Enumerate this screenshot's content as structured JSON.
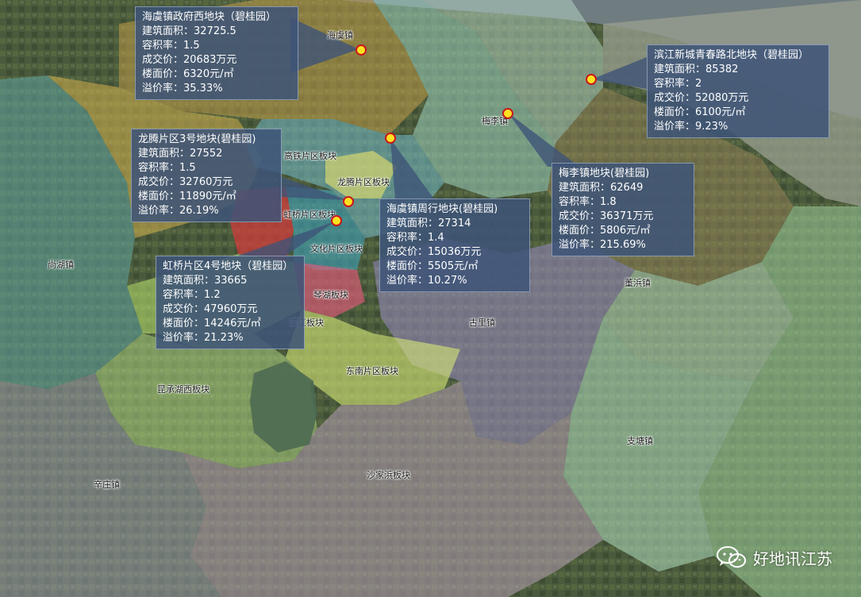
{
  "regions": {
    "haiyu": "海虞镇",
    "meili": "梅李镇",
    "longteng": "龙腾片区板块",
    "gaotie": "高铁片区板块",
    "hongqiao": "虹桥片区板块",
    "wenhua": "文化片区板块",
    "qinhu": "琴湖板块",
    "bingjiang": "滨江板块",
    "shanghu": "尚湖镇",
    "guli": "古里镇",
    "dongbang": "董浜镇",
    "dongnan": "东南片区板块",
    "kunchenghu": "昆承湖西板块",
    "zhitang": "支塘镇",
    "xinzhuang": "辛庄镇",
    "shajiabang": "沙家浜板块"
  },
  "parcels": [
    {
      "name": "海虞镇政府西地块（碧桂园）",
      "area": "建筑面积：32725.5",
      "far": "容积率：1.5",
      "price": "成交价：20683万元",
      "unit_price": "楼面价：6320元/㎡",
      "premium": "溢价率：35.33%"
    },
    {
      "name": "滨江新城青春路北地块（碧桂园）",
      "area": "建筑面积：85382",
      "far": "容积率：2",
      "price": "成交价：52080万元",
      "unit_price": "楼面价：6100元/㎡",
      "premium": "溢价率：9.23%"
    },
    {
      "name": "龙腾片区3号地块(碧桂园)",
      "area": "建筑面积：27552",
      "far": "容积率：1.5",
      "price": "成交价：32760万元",
      "unit_price": "楼面价：11890元/㎡",
      "premium": "溢价率：26.19%"
    },
    {
      "name": "梅李镇地块(碧桂园)",
      "area": "建筑面积：62649",
      "far": "容积率：1.8",
      "price": "成交价：36371万元",
      "unit_price": "楼面价：5806元/㎡",
      "premium": "溢价率：215.69%"
    },
    {
      "name": "海虞镇周行地块(碧桂园)",
      "area": "建筑面积：27314",
      "far": "容积率：1.4",
      "price": "成交价：15036万元",
      "unit_price": "楼面价：5505元/㎡",
      "premium": "溢价率：10.27%"
    },
    {
      "name": "虹桥片区4号地块（碧桂园）",
      "area": "建筑面积：33665",
      "far": "容积率：1.2",
      "price": "成交价：47960万元",
      "unit_price": "楼面价：14246元/㎡",
      "premium": "溢价率：21.23%"
    }
  ],
  "watermark": {
    "text": "好地讯江苏",
    "icon": "wechat-icon"
  },
  "colors": {
    "callout_bg": "#3e5478",
    "marker_fill": "#ffe21f",
    "marker_ring": "#c8171f"
  }
}
